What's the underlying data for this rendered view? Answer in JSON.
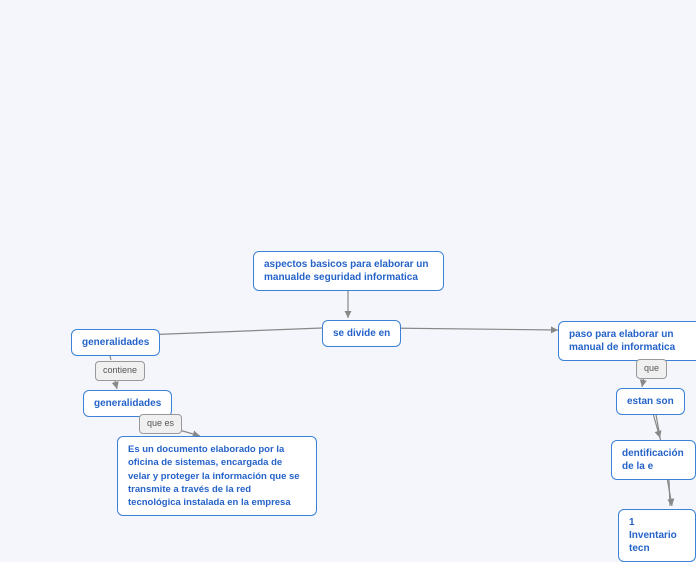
{
  "nodes": {
    "root": "aspectos basicos para elaborar un manualde seguridad informatica",
    "divide": "se divide en",
    "generalidades1": "generalidades",
    "contiene": "contiene",
    "generalidades2": "generalidades",
    "quees": "que es",
    "desc": "Es un documento elaborado por la oficina de sistemas, encargada de velar y proteger la información que se transmite a través de la red tecnológica instalada en la empresa",
    "pasos": "paso para elaborar un manual de informatica",
    "que": "que",
    "estanson": "estan son",
    "identificacion": "dentificación de la e",
    "inventario": "1 Inventario tecn"
  }
}
